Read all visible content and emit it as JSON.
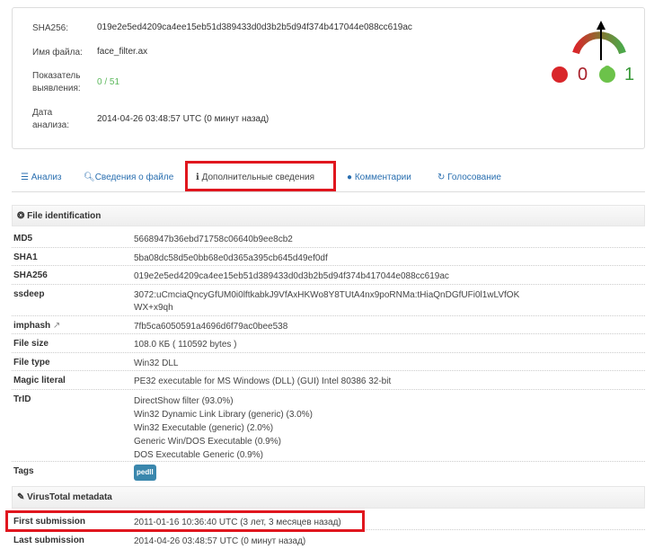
{
  "summary": {
    "sha256_label": "SHA256:",
    "sha256": "019e2e5ed4209ca4ee15eb51d389433d0d3b2b5d94f374b417044e088cc619ac",
    "filename_label": "Имя файла:",
    "filename": "face_filter.ax",
    "detection_label_1": "Показатель",
    "detection_label_2": "выявления:",
    "detection": "0 / 51",
    "date_label_1": "Дата",
    "date_label_2": "анализа:",
    "date": "2014-04-26 03:48:57 UTC (0 минут назад)",
    "votes_bad": "0",
    "votes_good": "1"
  },
  "colors": {
    "accent": "#2a6fb0",
    "highlight": "#e0161e",
    "bad": "#c9302c",
    "good": "#5cb85c"
  },
  "tabs": [
    {
      "label": "Анализ",
      "icon": "list-icon"
    },
    {
      "label": "Сведения о файле",
      "icon": "search-icon"
    },
    {
      "label": "Дополнительные сведения",
      "icon": "info-icon"
    },
    {
      "label": "Комментарии",
      "icon": "comment-icon"
    },
    {
      "label": "Голосование",
      "icon": "vote-icon"
    }
  ],
  "file_identification": {
    "title": "File identification",
    "rows": [
      {
        "label": "MD5",
        "value": "5668947b36ebd71758c06640b9ee8cb2"
      },
      {
        "label": "SHA1",
        "value": "5ba08dc58d5e0bb68e0d365a395cb645d49ef0df"
      },
      {
        "label": "SHA256",
        "value": "019e2e5ed4209ca4ee15eb51d389433d0d3b2b5d94f374b417044e088cc619ac"
      },
      {
        "label": "ssdeep",
        "value": "3072:uCmciaQncyGfUM0i0lftkabkJ9VfAxHKWo8Y8TUtA4nx9poRNMa:tHiaQnDGfUFi0l1wLVfOK",
        "value2": "WX+x9qh"
      },
      {
        "label": "imphash",
        "value": "7fb5ca6050591a4696d6f79ac0bee538"
      },
      {
        "label": "File size",
        "value": "108.0 КБ ( 110592 bytes )"
      },
      {
        "label": "File type",
        "value": "Win32 DLL"
      },
      {
        "label": "Magic literal",
        "value": "PE32 executable for MS Windows (DLL) (GUI) Intel 80386 32-bit"
      }
    ],
    "trid_label": "TrID",
    "trid": [
      "DirectShow filter (93.0%)",
      "Win32 Dynamic Link Library (generic) (3.0%)",
      "Win32 Executable (generic) (2.0%)",
      "Generic Win/DOS Executable (0.9%)",
      "DOS Executable Generic (0.9%)"
    ],
    "tags_label": "Tags",
    "tag": "pedll"
  },
  "vt_metadata": {
    "title": "VirusTotal metadata",
    "first_label": "First submission",
    "first": "2011-01-16 10:36:40 UTC (3 лет, 3 месяцев назад)",
    "last_label": "Last submission",
    "last": "2014-04-26 03:48:57 UTC (0 минут назад)"
  }
}
